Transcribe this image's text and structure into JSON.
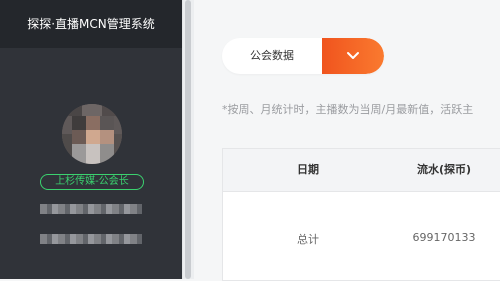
{
  "app": {
    "title": "探探·直播MCN管理系统"
  },
  "profile": {
    "role": "上杉传媒-公会长"
  },
  "filter": {
    "selected": "公会数据"
  },
  "note": "*按周、月统计时，主播数为当周/月最新值，活跃主",
  "table": {
    "headers": [
      "日期",
      "流水(探币)"
    ],
    "rows": [
      [
        "总计",
        "699170133"
      ]
    ]
  },
  "colors": {
    "accent": "#fa6a28",
    "badge": "#3bd26f",
    "sidebar": "#303339"
  }
}
